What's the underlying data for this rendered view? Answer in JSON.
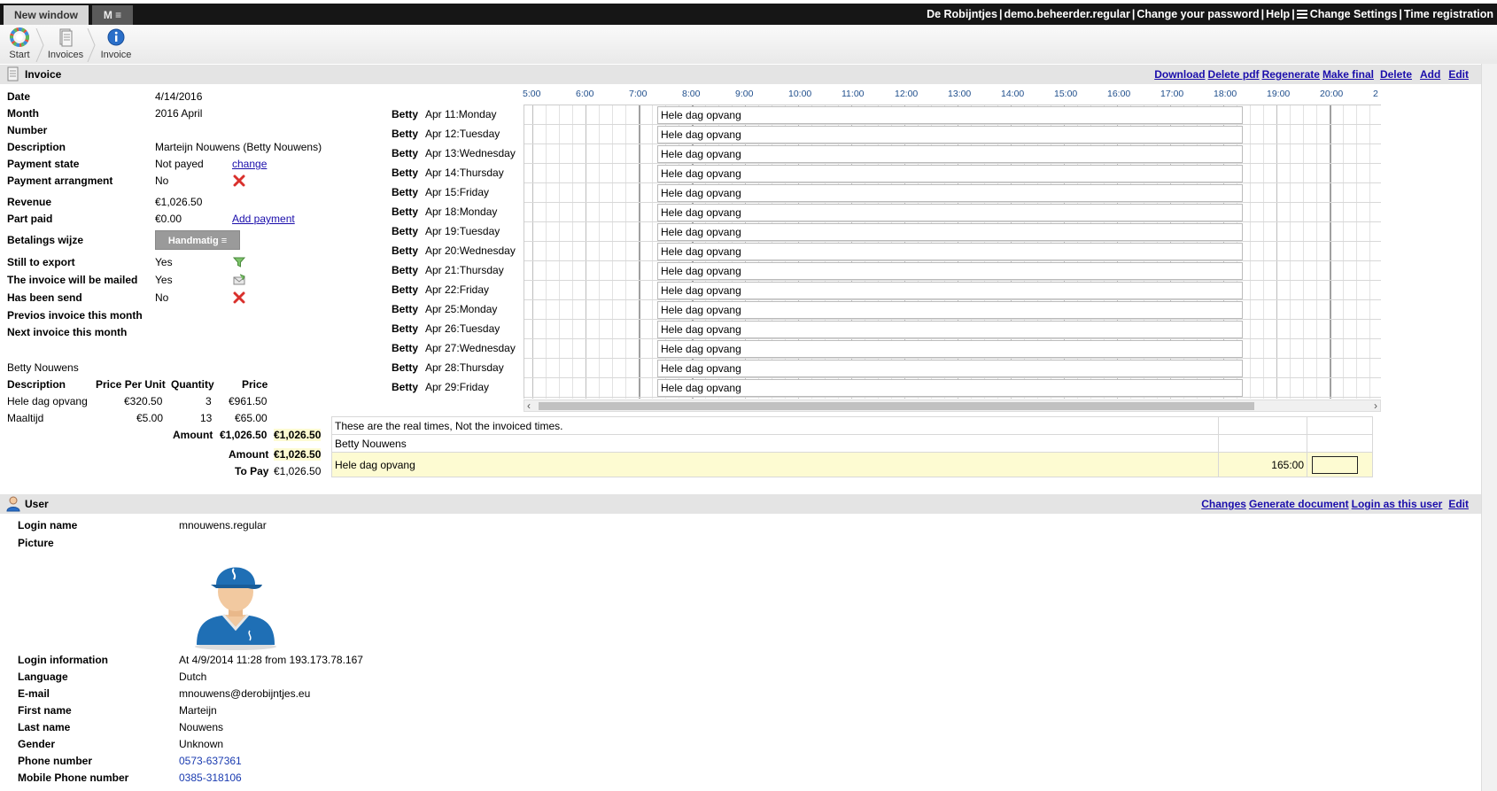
{
  "topbar": {
    "tab_new": "New window",
    "tab_m": "M ≡",
    "nav": [
      "De Robijntjes",
      "demo.beheerder.regular",
      "Change your password",
      "Help",
      "Change Settings",
      "Time registration"
    ]
  },
  "breadcrumb": [
    "Start",
    "Invoices",
    "Invoice"
  ],
  "invoice": {
    "title": "Invoice",
    "actions": [
      "Download",
      "Delete pdf",
      "Regenerate",
      "Make final",
      "Delete",
      "Add",
      "Edit"
    ],
    "fields": {
      "date_label": "Date",
      "date": "4/14/2016",
      "month_label": "Month",
      "month": "2016 April",
      "number_label": "Number",
      "description_label": "Description",
      "description": "Marteijn Nouwens (Betty Nouwens)",
      "payment_state_label": "Payment state",
      "payment_state": "Not payed",
      "payment_state_link": "change",
      "payment_arr_label": "Payment arrangment",
      "payment_arr": "No",
      "revenue_label": "Revenue",
      "revenue": "€1,026.50",
      "part_paid_label": "Part paid",
      "part_paid": "€0.00",
      "add_payment": "Add payment",
      "betalings_label": "Betalings wijze",
      "betalings_button": "Handmatig ≡",
      "still_export_label": "Still to export",
      "still_export": "Yes",
      "mailed_label": "The invoice will be mailed",
      "mailed": "Yes",
      "send_label": "Has been send",
      "send": "No",
      "prev_label": "Previos invoice this month",
      "next_label": "Next invoice this month"
    },
    "lines": {
      "person": "Betty Nouwens",
      "headers": [
        "Description",
        "Price Per Unit",
        "Quantity",
        "Price"
      ],
      "rows": [
        {
          "desc": "Hele dag opvang",
          "ppu": "€320.50",
          "qty": "3",
          "price": "€961.50"
        },
        {
          "desc": "Maaltijd",
          "ppu": "€5.00",
          "qty": "13",
          "price": "€65.00"
        }
      ],
      "amount_label": "Amount",
      "amount_1": "€1,026.50",
      "amount_2": "€1,026.50",
      "amount2_label": "Amount",
      "amount2_val": "€1,026.50",
      "topay_label": "To Pay",
      "topay_val": "€1,026.50"
    }
  },
  "calendar": {
    "ticks": [
      "5:00",
      "6:00",
      "7:00",
      "8:00",
      "9:00",
      "10:00",
      "11:00",
      "12:00",
      "13:00",
      "14:00",
      "15:00",
      "16:00",
      "17:00",
      "18:00",
      "19:00",
      "20:00",
      "2"
    ],
    "block_label": "Hele dag opvang",
    "days": [
      {
        "name": "Betty",
        "date": "Apr 11:Monday"
      },
      {
        "name": "Betty",
        "date": "Apr 12:Tuesday"
      },
      {
        "name": "Betty",
        "date": "Apr 13:Wednesday"
      },
      {
        "name": "Betty",
        "date": "Apr 14:Thursday"
      },
      {
        "name": "Betty",
        "date": "Apr 15:Friday"
      },
      {
        "name": "Betty",
        "date": "Apr 18:Monday"
      },
      {
        "name": "Betty",
        "date": "Apr 19:Tuesday"
      },
      {
        "name": "Betty",
        "date": "Apr 20:Wednesday"
      },
      {
        "name": "Betty",
        "date": "Apr 21:Thursday"
      },
      {
        "name": "Betty",
        "date": "Apr 22:Friday"
      },
      {
        "name": "Betty",
        "date": "Apr 25:Monday"
      },
      {
        "name": "Betty",
        "date": "Apr 26:Tuesday"
      },
      {
        "name": "Betty",
        "date": "Apr 27:Wednesday"
      },
      {
        "name": "Betty",
        "date": "Apr 28:Thursday"
      },
      {
        "name": "Betty",
        "date": "Apr 29:Friday"
      }
    ]
  },
  "real_times": {
    "note": "These are the real times, Not the invoiced times.",
    "person": "Betty Nouwens",
    "item": "Hele dag opvang",
    "hours": "165:00"
  },
  "user": {
    "title": "User",
    "actions": [
      "Changes",
      "Generate document",
      "Login as this user",
      "Edit"
    ],
    "login_name_label": "Login name",
    "login_name": "mnouwens.regular",
    "picture_label": "Picture",
    "login_info_label": "Login information",
    "login_info": "At 4/9/2014 11:28 from 193.173.78.167",
    "language_label": "Language",
    "language": "Dutch",
    "email_label": "E-mail",
    "email": "mnouwens@derobijntjes.eu",
    "first_name_label": "First name",
    "first_name": "Marteijn",
    "last_name_label": "Last name",
    "last_name": "Nouwens",
    "gender_label": "Gender",
    "gender": "Unknown",
    "phone_label": "Phone number",
    "phone": "0573-637361",
    "mobile_label": "Mobile Phone number",
    "mobile": "0385-318106"
  }
}
